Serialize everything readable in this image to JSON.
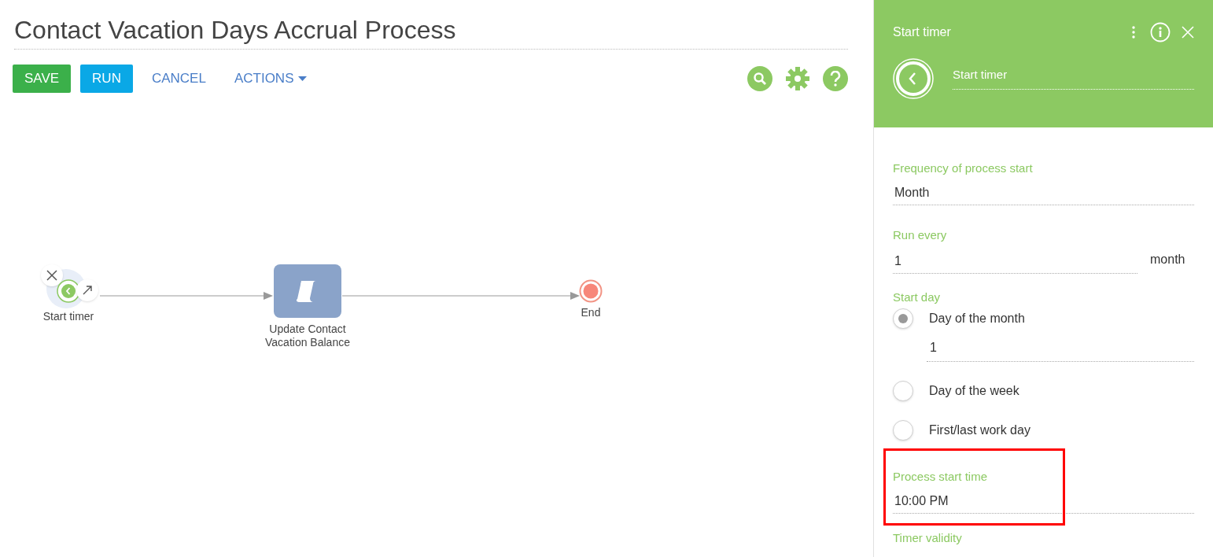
{
  "title": "Contact Vacation Days Accrual Process",
  "toolbar": {
    "buttons": [
      {
        "label": "SAVE",
        "kind": "save"
      },
      {
        "label": "RUN",
        "kind": "run"
      },
      {
        "label": "CANCEL",
        "kind": "link"
      },
      {
        "label": "ACTIONS",
        "kind": "menu"
      }
    ]
  },
  "diagram": {
    "nodes": [
      {
        "kind": "timer",
        "label": "Start timer",
        "selected": true
      },
      {
        "kind": "script",
        "label": "Update Contact Vacation Balance",
        "selected": false
      },
      {
        "kind": "end",
        "label": "End",
        "selected": false
      }
    ]
  },
  "panel": {
    "title": "Start timer",
    "element_name": "Start timer",
    "fields": [
      {
        "kind": "text",
        "label": "Frequency of process start",
        "value": "Month",
        "highlighted": false
      },
      {
        "kind": "text",
        "label": "Run every",
        "value": "1",
        "unit": "month",
        "highlighted": false
      },
      {
        "kind": "radio",
        "label": "Start day",
        "options": [
          {
            "label": "Day of the month",
            "selected": true,
            "value": "1"
          },
          {
            "label": "Day of the week",
            "selected": false
          },
          {
            "label": "First/last work day",
            "selected": false
          }
        ]
      },
      {
        "kind": "text",
        "label": "Process start time",
        "value": "10:00 PM",
        "highlighted": true
      },
      {
        "kind": "heading",
        "label": "Timer validity"
      }
    ]
  }
}
